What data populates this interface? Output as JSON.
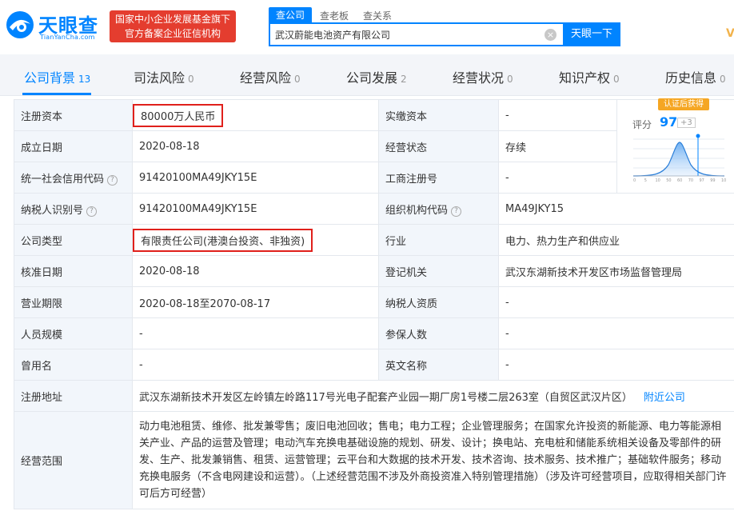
{
  "header": {
    "logo_text": "天眼查",
    "logo_sub": "TianYanCha.com",
    "badge_line1": "国家中小企业发展基金旗下",
    "badge_line2": "官方备案企业征信机构",
    "search_tabs": [
      "查公司",
      "查老板",
      "查关系"
    ],
    "search_value": "武汉蔚能电池资产有限公司",
    "search_button": "天眼一下",
    "clear_icon": "×",
    "v_mark": "V"
  },
  "tabs": [
    {
      "label": "公司背景",
      "count": "13"
    },
    {
      "label": "司法风险",
      "count": "0"
    },
    {
      "label": "经营风险",
      "count": "0"
    },
    {
      "label": "公司发展",
      "count": "2"
    },
    {
      "label": "经营状况",
      "count": "0"
    },
    {
      "label": "知识产权",
      "count": "0"
    },
    {
      "label": "历史信息",
      "count": "0"
    }
  ],
  "info": {
    "reg_capital_label": "注册资本",
    "reg_capital": "80000万人民币",
    "paid_capital_label": "实缴资本",
    "paid_capital": "-",
    "est_date_label": "成立日期",
    "est_date": "2020-08-18",
    "status_label": "经营状态",
    "status": "存续",
    "credit_code_label": "统一社会信用代码",
    "credit_code": "91420100MA49JKY15E",
    "reg_no_label": "工商注册号",
    "reg_no": "-",
    "tax_id_label": "纳税人识别号",
    "tax_id": "91420100MA49JKY15E",
    "org_code_label": "组织机构代码",
    "org_code": "MA49JKY15",
    "type_label": "公司类型",
    "type": "有限责任公司(港澳台投资、非独资)",
    "industry_label": "行业",
    "industry": "电力、热力生产和供应业",
    "approve_date_label": "核准日期",
    "approve_date": "2020-08-18",
    "authority_label": "登记机关",
    "authority": "武汉东湖新技术开发区市场监督管理局",
    "term_label": "营业期限",
    "term": "2020-08-18至2070-08-17",
    "taxpayer_label": "纳税人资质",
    "taxpayer": "-",
    "staff_label": "人员规模",
    "staff": "-",
    "insured_label": "参保人数",
    "insured": "-",
    "former_name_label": "曾用名",
    "former_name": "-",
    "en_name_label": "英文名称",
    "en_name": "-",
    "address_label": "注册地址",
    "address": "武汉东湖新技术开发区左岭镇左岭路117号光电子配套产业园一期厂房1号楼二层263室（自贸区武汉片区）",
    "nearby": "附近公司",
    "scope_label": "经营范围",
    "scope": "动力电池租赁、维修、批发兼零售；废旧电池回收；售电；电力工程；企业管理服务；在国家允许投资的新能源、电力等能源相关产业、产品的运营及管理；电动汽车充换电基础设施的规划、研发、设计；换电站、充电桩和储能系统相关设备及零部件的研发、生产、批发兼销售、租赁、运营管理；云平台和大数据的技术开发、技术咨询、技术服务、技术推广；基础软件服务；移动充换电服务（不含电网建设和运营）。（上述经营范围不涉及外商投资准入特别管理措施）（涉及许可经营项目，应取得相关部门许可后方可经营）",
    "help_icon": "?"
  },
  "score": {
    "badge": "认证后获得",
    "label": "评分",
    "value": "97",
    "delta": "+3",
    "ticks": [
      "0",
      "5",
      "10",
      "50",
      "60",
      "70",
      "97",
      "99",
      "100"
    ]
  },
  "colors": {
    "brand_blue": "#0084ff",
    "badge_red": "#e43d2f",
    "highlight_red": "#e0201b",
    "label_bg": "#f2f6fb"
  }
}
